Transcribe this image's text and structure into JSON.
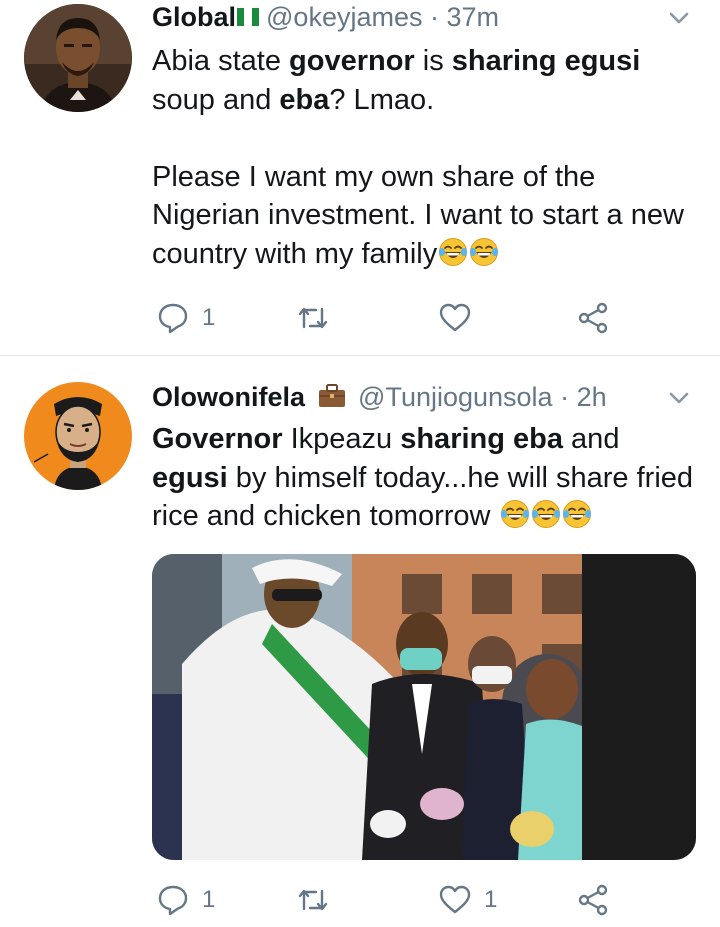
{
  "tweets": [
    {
      "display_name": "Global",
      "handle": "@okeyjames",
      "time": "· 37m",
      "text_segments": [
        [
          {
            "t": "Abia state ",
            "b": false
          },
          {
            "t": "governor",
            "b": true
          },
          {
            "t": " is ",
            "b": false
          },
          {
            "t": "sharing egusi",
            "b": true
          },
          {
            "t": " soup and ",
            "b": false
          },
          {
            "t": "eba",
            "b": true
          },
          {
            "t": "? Lmao.",
            "b": false
          }
        ],
        [
          {
            "t": "Please I want my own share of the Nigerian investment. I want to start a new country with my family",
            "b": false
          }
        ]
      ],
      "emoji_count": 2,
      "replies": "1",
      "retweets": "",
      "likes": "",
      "badge_icon": "nigeria-flag-icon"
    },
    {
      "display_name": "Olowonifela",
      "handle": "@Tunjiogunsola",
      "time": "· 2h",
      "text_segments": [
        [
          {
            "t": "Governor",
            "b": true
          },
          {
            "t": " Ikpeazu ",
            "b": false
          },
          {
            "t": "sharing eba",
            "b": true
          },
          {
            "t": " and ",
            "b": false
          },
          {
            "t": "egusi",
            "b": true
          },
          {
            "t": " by himself today...he will share fried rice and chicken tomorrow ",
            "b": false
          }
        ]
      ],
      "emoji_count": 3,
      "replies": "1",
      "retweets": "",
      "likes": "1",
      "badge_icon": "briefcase-icon",
      "media_icon": "photo-governor-sharing-food"
    }
  ],
  "colors": {
    "text": "#14171a",
    "secondary": "#657786",
    "divider": "#e1e8ed",
    "avatar2_bg": "#f08a1c"
  }
}
